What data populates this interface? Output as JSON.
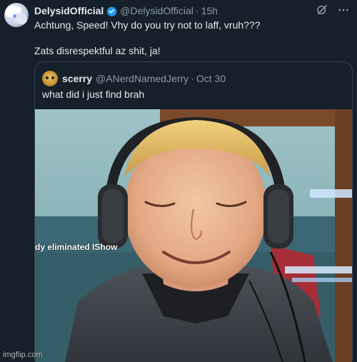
{
  "tweet": {
    "display_name": "DelysidOfficial",
    "handle": "@DelysidOfficial",
    "separator": "·",
    "time": "15h",
    "text": "Achtung, Speed! Vhy do you try not to laff, vruh???\n\nZats disrespektful az shit, ja!"
  },
  "quoted": {
    "display_name": "scerry",
    "handle": "@ANerdNamedJerry",
    "separator": "·",
    "time": "Oct 30",
    "text": "what did i just find brah",
    "overlay_text": "dy eliminated IShow"
  },
  "watermark": "imgflip.com",
  "icons": {
    "verified": "verified-badge-icon",
    "grok": "grok-icon",
    "more": "more-options-icon"
  },
  "colors": {
    "background": "#15202b",
    "verified": "#1d9bf0",
    "secondary_text": "#8b98a5",
    "border": "#38444d"
  }
}
